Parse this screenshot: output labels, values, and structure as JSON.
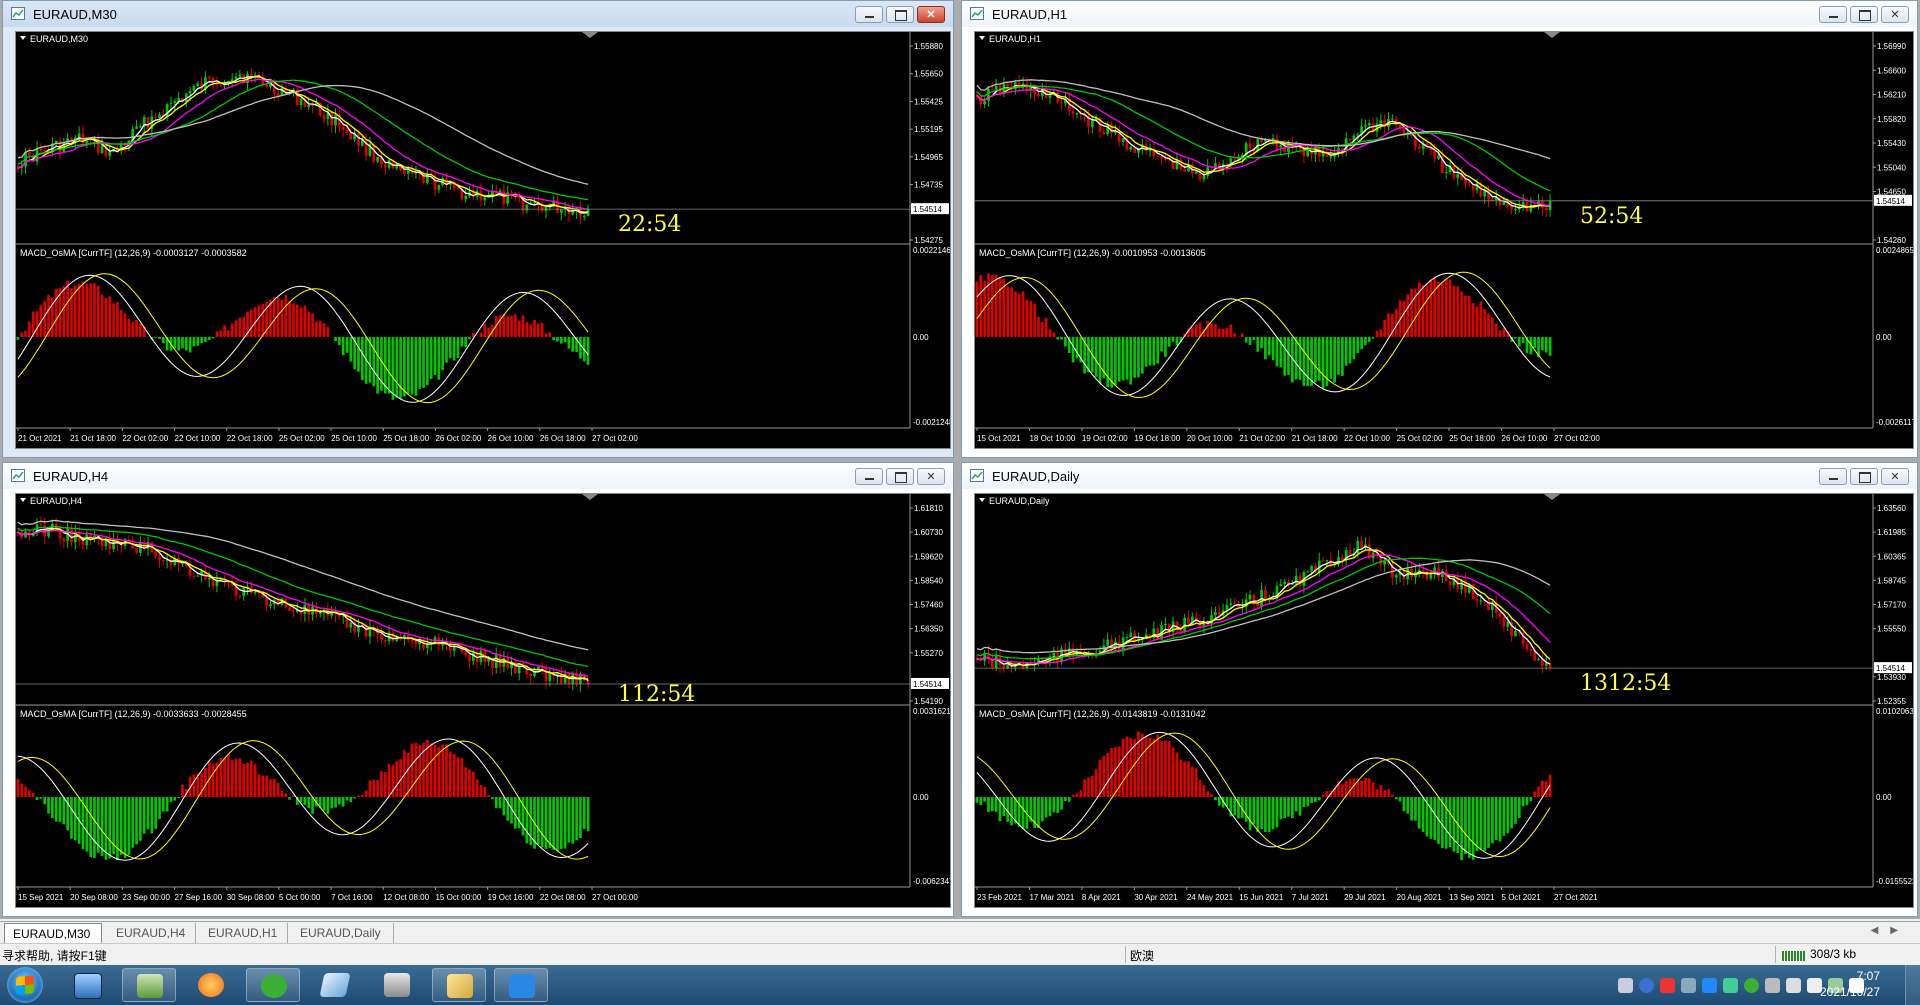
{
  "workspace": {
    "windows": [
      {
        "id": "m30",
        "title": "EURAUD,M30",
        "chart_label": "EURAUD,M30",
        "countdown": "22:54",
        "current_price": "1.54514",
        "price_ticks": [
          "1.55880",
          "1.55650",
          "1.55425",
          "1.55195",
          "1.54965",
          "1.54735",
          "1.54514",
          "1.54275"
        ],
        "indicator_label": "MACD_OsMA [CurrTF] (12,26,9) -0.0003127 -0.0003582",
        "indicator_ticks": [
          "0.0022146",
          "0.00",
          "-0.0021248"
        ],
        "time_ticks": [
          "21 Oct 2021",
          "21 Oct 18:00",
          "22 Oct 02:00",
          "22 Oct 10:00",
          "22 Oct 18:00",
          "25 Oct 02:00",
          "25 Oct 10:00",
          "25 Oct 18:00",
          "26 Oct 02:00",
          "26 Oct 10:00",
          "26 Oct 18:00",
          "27 Oct 02:00"
        ]
      },
      {
        "id": "h1",
        "title": "EURAUD,H1",
        "chart_label": "EURAUD,H1",
        "countdown": "52:54",
        "current_price": "1.54514",
        "price_ticks": [
          "1.56990",
          "1.56600",
          "1.56210",
          "1.55820",
          "1.55430",
          "1.55040",
          "1.54650",
          "1.54514",
          "1.54260"
        ],
        "indicator_label": "MACD_OsMA [CurrTF] (12,26,9) -0.0010953 -0.0013605",
        "indicator_ticks": [
          "0.0024865",
          "0.00",
          "-0.0026117"
        ],
        "time_ticks": [
          "15 Oct 2021",
          "18 Oct 10:00",
          "19 Oct 02:00",
          "19 Oct 18:00",
          "20 Oct 10:00",
          "21 Oct 02:00",
          "21 Oct 18:00",
          "22 Oct 10:00",
          "25 Oct 02:00",
          "25 Oct 18:00",
          "26 Oct 10:00",
          "27 Oct 02:00"
        ]
      },
      {
        "id": "h4",
        "title": "EURAUD,H4",
        "chart_label": "EURAUD,H4",
        "countdown": "112:54",
        "current_price": "1.54514",
        "price_ticks": [
          "1.61810",
          "1.60730",
          "1.59620",
          "1.58540",
          "1.57460",
          "1.56350",
          "1.55270",
          "1.54514",
          "1.54190"
        ],
        "indicator_label": "MACD_OsMA [CurrTF] (12,26,9) -0.0033633 -0.0028455",
        "indicator_ticks": [
          "0.0031621",
          "0.00",
          "-0.0062347"
        ],
        "time_ticks": [
          "15 Sep 2021",
          "20 Sep 08:00",
          "23 Sep 00:00",
          "27 Sep 16:00",
          "30 Sep 08:00",
          "5 Oct 00:00",
          "7 Oct 16:00",
          "12 Oct 08:00",
          "15 Oct 00:00",
          "19 Oct 16:00",
          "22 Oct 08:00",
          "27 Oct 00:00"
        ]
      },
      {
        "id": "daily",
        "title": "EURAUD,Daily",
        "chart_label": "EURAUD,Daily",
        "countdown": "1312:54",
        "current_price": "1.54514",
        "price_ticks": [
          "1.63560",
          "1.61985",
          "1.60365",
          "1.58745",
          "1.57170",
          "1.55550",
          "1.54514",
          "1.53930",
          "1.52355"
        ],
        "indicator_label": "MACD_OsMA [CurrTF] (12,26,9) -0.0143819 -0.0131042",
        "indicator_ticks": [
          "0.0102063",
          "0.00",
          "-0.0155522"
        ],
        "time_ticks": [
          "23 Feb 2021",
          "17 Mar 2021",
          "8 Apr 2021",
          "30 Apr 2021",
          "24 May 2021",
          "15 Jun 2021",
          "7 Jul 2021",
          "29 Jul 2021",
          "20 Aug 2021",
          "13 Sep 2021",
          "5 Oct 2021",
          "27 Oct 2021"
        ]
      }
    ]
  },
  "tabs": [
    "EURAUD,M30",
    "EURAUD,H4",
    "EURAUD,H1",
    "EURAUD,Daily"
  ],
  "active_tab": "EURAUD,M30",
  "status": {
    "help": "寻求帮助, 请按F1键",
    "profile": "欧澳",
    "traffic": "308/3 kb"
  },
  "taskbar": {
    "time": "7:07",
    "date": "2021/10/27",
    "apps": [
      "windows-explorer-icon",
      "control-panel-icon",
      "browser-icon",
      "wechat-icon",
      "notepad-icon",
      "installer-icon",
      "metatrader-icon",
      "feishu-icon"
    ]
  },
  "colors": {
    "bull": "#00c800",
    "bear": "#e00000",
    "ma_fast": "#ffffff",
    "ma_yellow": "#ffff00",
    "ma_magenta": "#ff00ff",
    "ma_green": "#00c800",
    "ma_gray": "#c0c0c0",
    "countdown": "#ffff40"
  }
}
